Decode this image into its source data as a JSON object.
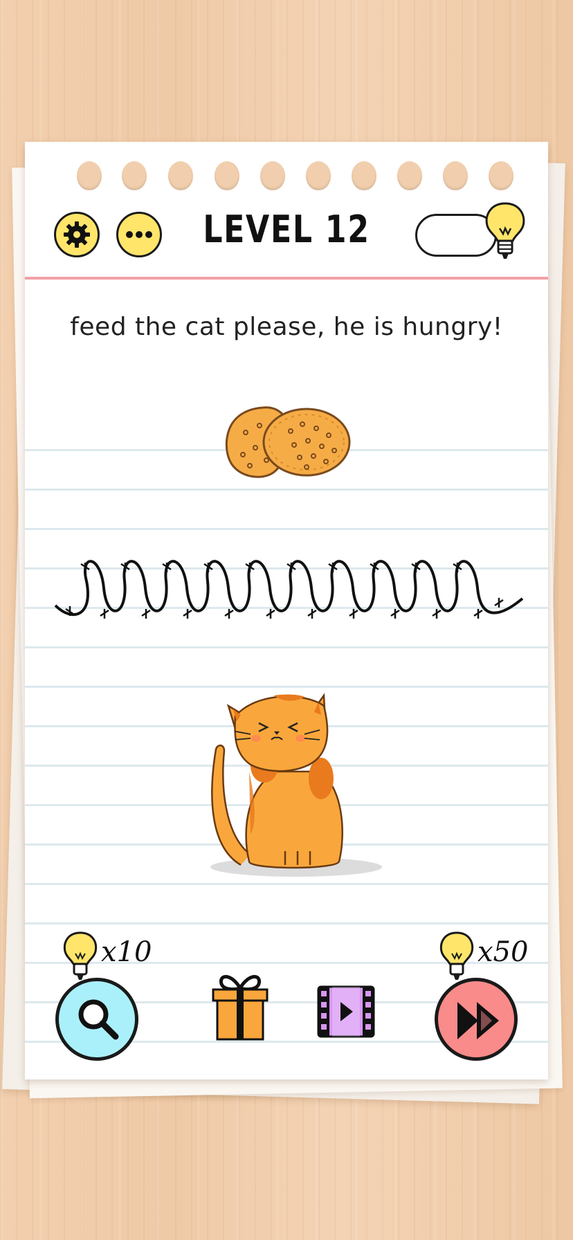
{
  "header": {
    "title": "LEVEL 12",
    "settings_icon": "gear-icon",
    "more_icon": "more-dots-icon",
    "hint_icon": "lightbulb-icon"
  },
  "question": "feed the cat please, he is hungry!",
  "scene": {
    "food": "cookies",
    "obstacle": "barbed-wire",
    "character": "orange-cat"
  },
  "toolbar": {
    "hint_cost_label": "x10",
    "skip_cost_label": "x50",
    "hint_button_icon": "magnifier-icon",
    "gift_icon": "gift-icon",
    "video_icon": "video-icon",
    "skip_button_icon": "fast-forward-icon"
  },
  "colors": {
    "yellow": "#ffe56a",
    "cyan": "#aaf0fb",
    "pink": "#fa8b8b",
    "purple": "#d996f5",
    "orange": "#f9a73c",
    "red_line": "#f2a0a7"
  }
}
